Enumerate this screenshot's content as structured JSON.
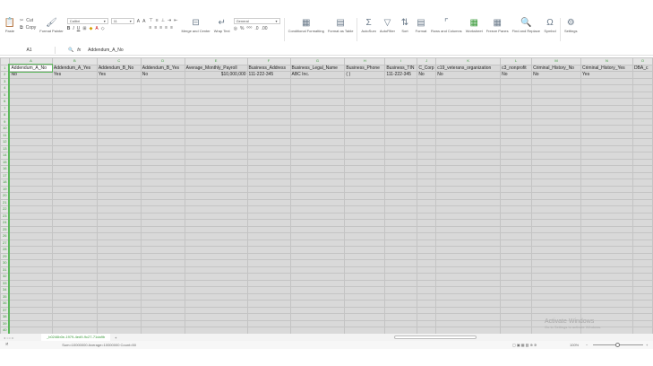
{
  "ribbon": {
    "paste": "Paste",
    "cut": "Cut",
    "copy": "Copy",
    "format_painter": "Format Painter",
    "font": "Calibri",
    "size": "11",
    "merge": "Merge and Center",
    "wrap": "Wrap Text",
    "number_format": "General",
    "conditional": "Conditional Formatting",
    "format_table": "Format as Table",
    "autosum": "AutoSum",
    "autofilter": "AutoFilter",
    "sort": "Sort",
    "format": "Format",
    "rows_cols": "Rows and Columns",
    "worksheet": "Worksheet",
    "freeze": "Freeze Panes",
    "find": "Find and Replace",
    "symbol": "Symbol",
    "settings": "Settings"
  },
  "formula_bar": {
    "cell_ref": "A1",
    "fx": "fx",
    "value": "Addendum_A_No"
  },
  "columns": [
    "A",
    "B",
    "C",
    "D",
    "E",
    "F",
    "G",
    "H",
    "I",
    "J",
    "K",
    "L",
    "M",
    "N",
    "O"
  ],
  "rows": [
    [
      "Addendum_A_No",
      "Addendum_A_Yes",
      "Addendum_B_No",
      "Addendum_B_Yes",
      "Average_Monthly_Payroll",
      "Business_Address",
      "Business_Legal_Name",
      "Business_Phone",
      "Business_TIN",
      "C_Corp",
      "c19_veterans_organization",
      "c3_nonprofit",
      "Criminal_History_No",
      "Criminal_History_Yes",
      "DBA_c"
    ],
    [
      "No",
      "Yes",
      "Yes",
      "No",
      "$10,000,000",
      "111-222-345",
      "ABC Inc.",
      "( )",
      "111-222-345",
      "No",
      "No",
      "No",
      "No",
      "Yes",
      ""
    ]
  ],
  "row_count": 40,
  "sheet_tab": "_b0246b0e-1979-4ed9-9c27-71da9b",
  "status": "Sum=10000000 Average=10000000 Count=50",
  "zoom": "100%",
  "watermark": {
    "title": "Activate Windows",
    "sub": "Go to Settings to activate Windows."
  }
}
